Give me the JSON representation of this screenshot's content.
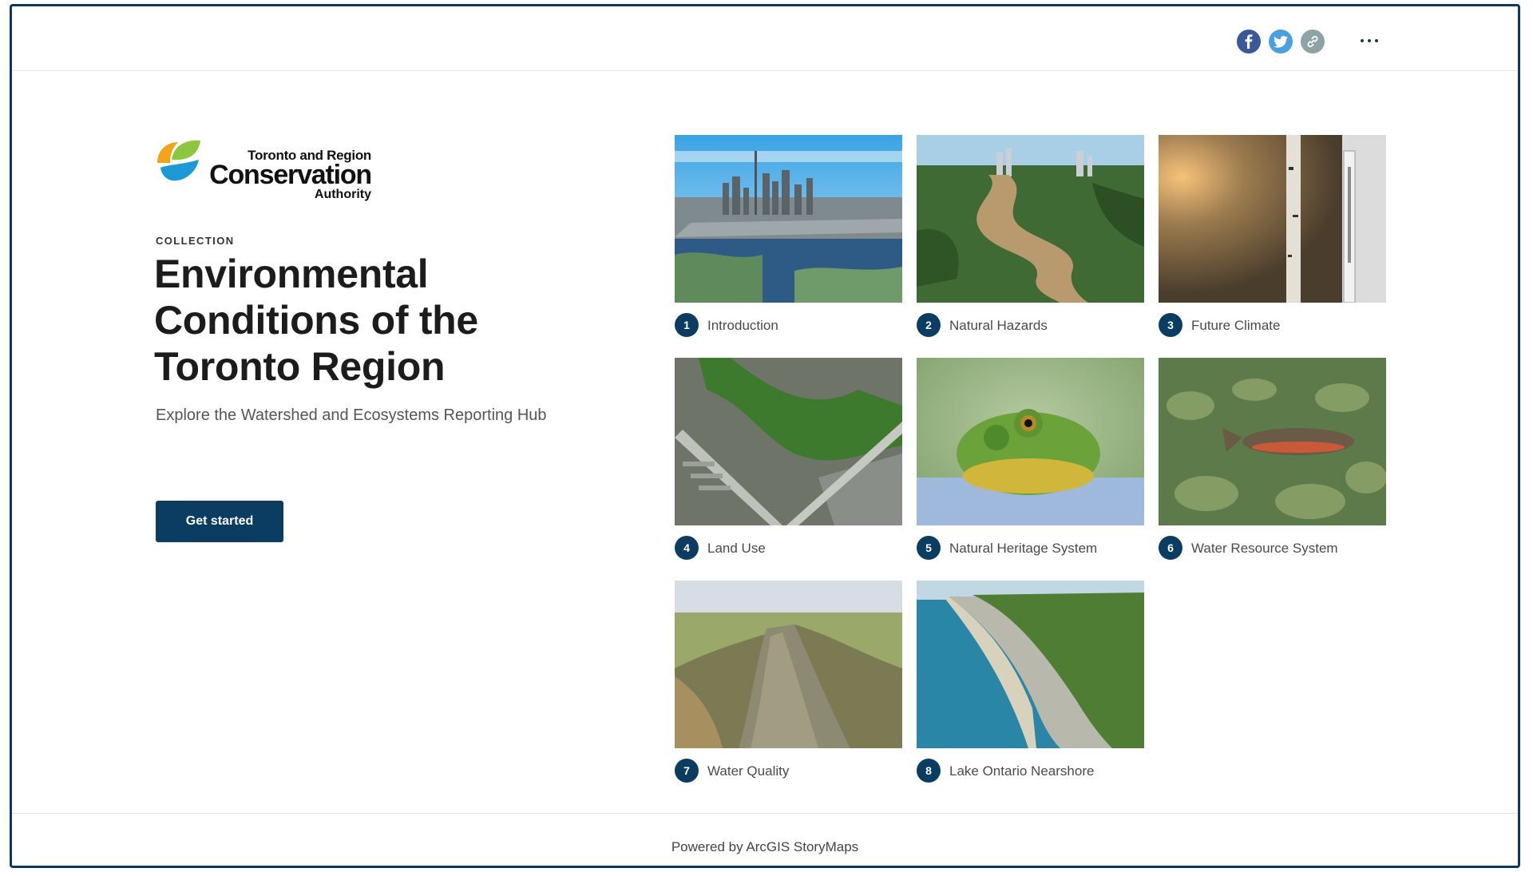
{
  "header": {
    "share": [
      {
        "name": "facebook",
        "icon": "facebook-icon",
        "color": "#3b5998"
      },
      {
        "name": "twitter",
        "icon": "twitter-icon",
        "color": "#4a9fe0"
      },
      {
        "name": "copy-link",
        "icon": "link-icon",
        "color": "#8da3a6"
      }
    ],
    "more_icon": "more-options-icon"
  },
  "logo": {
    "line1": "Toronto and Region",
    "line2": "Conservation",
    "line3": "Authority",
    "colors": [
      "#f5a21c",
      "#8dc63f",
      "#1d9ad6"
    ]
  },
  "hero": {
    "eyebrow": "COLLECTION",
    "title": "Environmental Conditions of the Toronto Region",
    "subtitle": "Explore the Watershed and Ecosystems Reporting Hub",
    "cta_label": "Get started",
    "accent": "#0b3d63"
  },
  "cards": [
    {
      "number": "1",
      "label": "Introduction",
      "image": "toronto-skyline-aerial"
    },
    {
      "number": "2",
      "label": "Natural Hazards",
      "image": "flooded-river-valley"
    },
    {
      "number": "3",
      "label": "Future Climate",
      "image": "birch-tree-thermometer"
    },
    {
      "number": "4",
      "label": "Land Use",
      "image": "suburban-aerial"
    },
    {
      "number": "5",
      "label": "Natural Heritage System",
      "image": "green-frog"
    },
    {
      "number": "6",
      "label": "Water Resource System",
      "image": "trout-underwater"
    },
    {
      "number": "7",
      "label": "Water Quality",
      "image": "river-spring"
    },
    {
      "number": "8",
      "label": "Lake Ontario Nearshore",
      "image": "bluffs-shoreline"
    }
  ],
  "footer": {
    "text": "Powered by ArcGIS StoryMaps"
  }
}
